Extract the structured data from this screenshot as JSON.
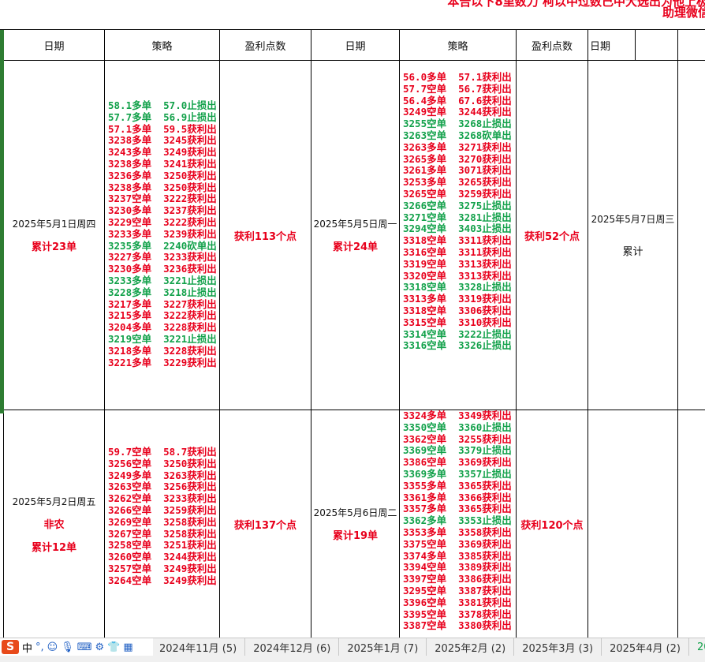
{
  "banner": {
    "line1": "本告以下8里数力 柯以中过数己中大选出为他上极",
    "line2": "助理微信"
  },
  "headers": [
    "日期",
    "策略",
    "盈利点数",
    "日期",
    "策略",
    "盈利点数",
    "日期"
  ],
  "rows": [
    {
      "left": {
        "date": "2025年5月1日周四",
        "tags": [],
        "total": "累计23单",
        "profit": "获利113个点",
        "lines": [
          {
            "t": "58.1多单  57.0止损出",
            "c": "g"
          },
          {
            "t": "57.7多单  56.9止损出",
            "c": "g"
          },
          {
            "t": "57.1多单  59.5获利出",
            "c": "r"
          },
          {
            "t": "3238多单  3245获利出",
            "c": "r"
          },
          {
            "t": "3243多单  3249获利出",
            "c": "r"
          },
          {
            "t": "3238多单  3241获利出",
            "c": "r"
          },
          {
            "t": "3236多单  3250获利出",
            "c": "r"
          },
          {
            "t": "3238多单  3250获利出",
            "c": "r"
          },
          {
            "t": "3237空单  3222获利出",
            "c": "r"
          },
          {
            "t": "3230多单  3237获利出",
            "c": "r"
          },
          {
            "t": "3229空单  3222获利出",
            "c": "r"
          },
          {
            "t": "3233多单  3239获利出",
            "c": "r"
          },
          {
            "t": "3235多单  2240砍单出",
            "c": "g"
          },
          {
            "t": "3227多单  3233获利出",
            "c": "r"
          },
          {
            "t": "3230多单  3236获利出",
            "c": "r"
          },
          {
            "t": "3233多单  3221止损出",
            "c": "g"
          },
          {
            "t": "3228多单  3218止损出",
            "c": "g"
          },
          {
            "t": "3217多单  3227获利出",
            "c": "r"
          },
          {
            "t": "3215多单  3222获利出",
            "c": "r"
          },
          {
            "t": "3204多单  3228获利出",
            "c": "r"
          },
          {
            "t": "3219空单  3221止损出",
            "c": "g"
          },
          {
            "t": "3218多单  3228获利出",
            "c": "r"
          },
          {
            "t": "3221多单  3229获利出",
            "c": "r"
          }
        ]
      },
      "right": {
        "date": "2025年5月5日周一",
        "total": "累计24单",
        "profit": "获利52个点",
        "lines": [
          {
            "t": "56.0多单  57.1获利出",
            "c": "r"
          },
          {
            "t": "57.7空单  56.7获利出",
            "c": "r"
          },
          {
            "t": "56.4多单  67.6获利出",
            "c": "r"
          },
          {
            "t": "3249空单  3244获利出",
            "c": "r"
          },
          {
            "t": "3255空单  3268止损出",
            "c": "g"
          },
          {
            "t": "3263空单  3268砍单出",
            "c": "g"
          },
          {
            "t": "3263多单  3271获利出",
            "c": "r"
          },
          {
            "t": "3265多单  3270获利出",
            "c": "r"
          },
          {
            "t": "3261多单  3071获利出",
            "c": "r"
          },
          {
            "t": "3253多单  3265获利出",
            "c": "r"
          },
          {
            "t": "3265空单  3259获利出",
            "c": "r"
          },
          {
            "t": "3266空单  3275止损出",
            "c": "g"
          },
          {
            "t": "3271空单  3281止损出",
            "c": "g"
          },
          {
            "t": "3294空单  3403止损出",
            "c": "g"
          },
          {
            "t": "3318空单  3311获利出",
            "c": "r"
          },
          {
            "t": "3316空单  3311获利出",
            "c": "r"
          },
          {
            "t": "3319空单  3313获利出",
            "c": "r"
          },
          {
            "t": "3320空单  3313获利出",
            "c": "r"
          },
          {
            "t": "3318空单  3328止损出",
            "c": "g"
          },
          {
            "t": "3313多单  3319获利出",
            "c": "r"
          },
          {
            "t": "3318空单  3306获利出",
            "c": "r"
          },
          {
            "t": "3315空单  3310获利出",
            "c": "r"
          },
          {
            "t": "3314空单  3222止损出",
            "c": "g"
          },
          {
            "t": "3316空单  3326止损出",
            "c": "g"
          }
        ]
      },
      "third": {
        "date": "2025年5月7日周三",
        "total": "累计"
      }
    },
    {
      "left": {
        "date": "2025年5月2日周五",
        "tag": "非农",
        "total": "累计12单",
        "profit": "获利137个点",
        "lines": [
          {
            "t": "59.7空单  58.7获利出",
            "c": "r"
          },
          {
            "t": "3256空单  3250获利出",
            "c": "r"
          },
          {
            "t": "3249多单  3263获利出",
            "c": "r"
          },
          {
            "t": "3263空单  3256获利出",
            "c": "r"
          },
          {
            "t": "3262空单  3233获利出",
            "c": "r"
          },
          {
            "t": "3266空单  3259获利出",
            "c": "r"
          },
          {
            "t": "3269空单  3258获利出",
            "c": "r"
          },
          {
            "t": "3267空单  3258获利出",
            "c": "r"
          },
          {
            "t": "3258空单  3251获利出",
            "c": "r"
          },
          {
            "t": "3260空单  3244获利出",
            "c": "r"
          },
          {
            "t": "3257空单  3249获利出",
            "c": "r"
          },
          {
            "t": "3264空单  3249获利出",
            "c": "r"
          }
        ]
      },
      "right": {
        "date": "2025年5月6日周二",
        "total": "累计19单",
        "profit": "获利120个点",
        "lines": [
          {
            "t": "3324多单  3349获利出",
            "c": "r"
          },
          {
            "t": "3350空单  3360止损出",
            "c": "g"
          },
          {
            "t": "3362空单  3255获利出",
            "c": "r"
          },
          {
            "t": "3369空单  3379止损出",
            "c": "g"
          },
          {
            "t": "3386空单  3369获利出",
            "c": "r"
          },
          {
            "t": "3369多单  3357止损出",
            "c": "g"
          },
          {
            "t": "3355多单  3365获利出",
            "c": "r"
          },
          {
            "t": "3361多单  3366获利出",
            "c": "r"
          },
          {
            "t": "3357多单  3365获利出",
            "c": "r"
          },
          {
            "t": "3362多单  3353止损出",
            "c": "g"
          },
          {
            "t": "3353多单  3358获利出",
            "c": "r"
          },
          {
            "t": "3375空单  3369获利出",
            "c": "r"
          },
          {
            "t": "3374多单  3385获利出",
            "c": "r"
          },
          {
            "t": "3394空单  3389获利出",
            "c": "r"
          },
          {
            "t": "3397空单  3386获利出",
            "c": "r"
          },
          {
            "t": "3295空单  3387获利出",
            "c": "r"
          },
          {
            "t": "3396空单  3381获利出",
            "c": "r"
          },
          {
            "t": "3395空单  3378获利出",
            "c": "r"
          },
          {
            "t": "3387空单  3380获利出",
            "c": "r"
          }
        ]
      }
    }
  ],
  "taskbar": {
    "ime_label": "中",
    "tabs": [
      "2024年11月 (5)",
      "2024年12月 (6)",
      "2025年1月 (7)",
      "2025年2月 (2)",
      "2025年3月 (3)",
      "2025年4月 (2)",
      "2025"
    ]
  }
}
